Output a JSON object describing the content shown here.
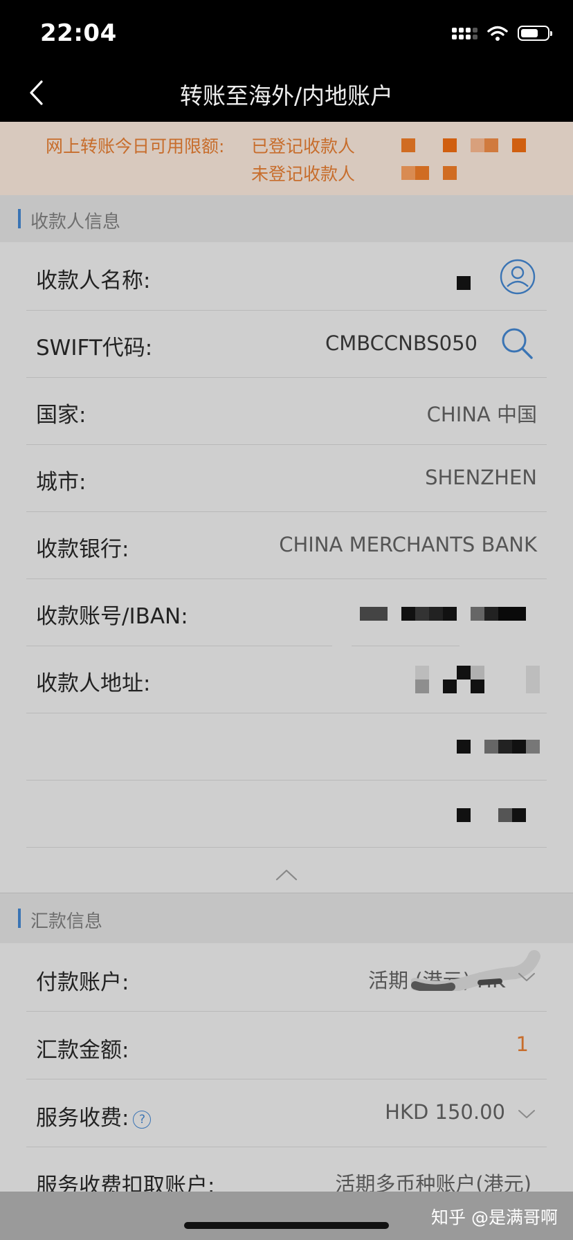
{
  "status": {
    "time": "22:04"
  },
  "nav": {
    "title": "转账至海外/内地账户"
  },
  "limit": {
    "label": "网上转账今日可用限额:",
    "registered": "已登记收款人",
    "unregistered": "未登记收款人"
  },
  "payee_section": {
    "title": "收款人信息",
    "rows": [
      {
        "label": "收款人名称:",
        "value": ""
      },
      {
        "label": "SWIFT代码:",
        "value": "CMBCCNBS050"
      },
      {
        "label": "国家:",
        "value": "CHINA 中国"
      },
      {
        "label": "城市:",
        "value": "SHENZHEN"
      },
      {
        "label": "收款银行:",
        "value": "CHINA MERCHANTS BANK"
      },
      {
        "label": "收款账号/IBAN:",
        "value": ""
      },
      {
        "label": "收款人地址:",
        "value": ""
      }
    ]
  },
  "remit_section": {
    "title": "汇款信息",
    "rows": [
      {
        "label": "付款账户:",
        "value": "活期 (港元) HK"
      },
      {
        "label": "汇款金额:",
        "value": "1"
      },
      {
        "label": "服务收费:",
        "value": "HKD 150.00",
        "help": "?"
      },
      {
        "label": "服务收费扣取账户:",
        "value": "活期多币种账户(港元)"
      }
    ]
  },
  "watermark": "知乎 @是满哥啊",
  "colors": {
    "accent": "#3a74b4",
    "limit_text": "#c76d2c",
    "amount": "#c76d2c"
  }
}
